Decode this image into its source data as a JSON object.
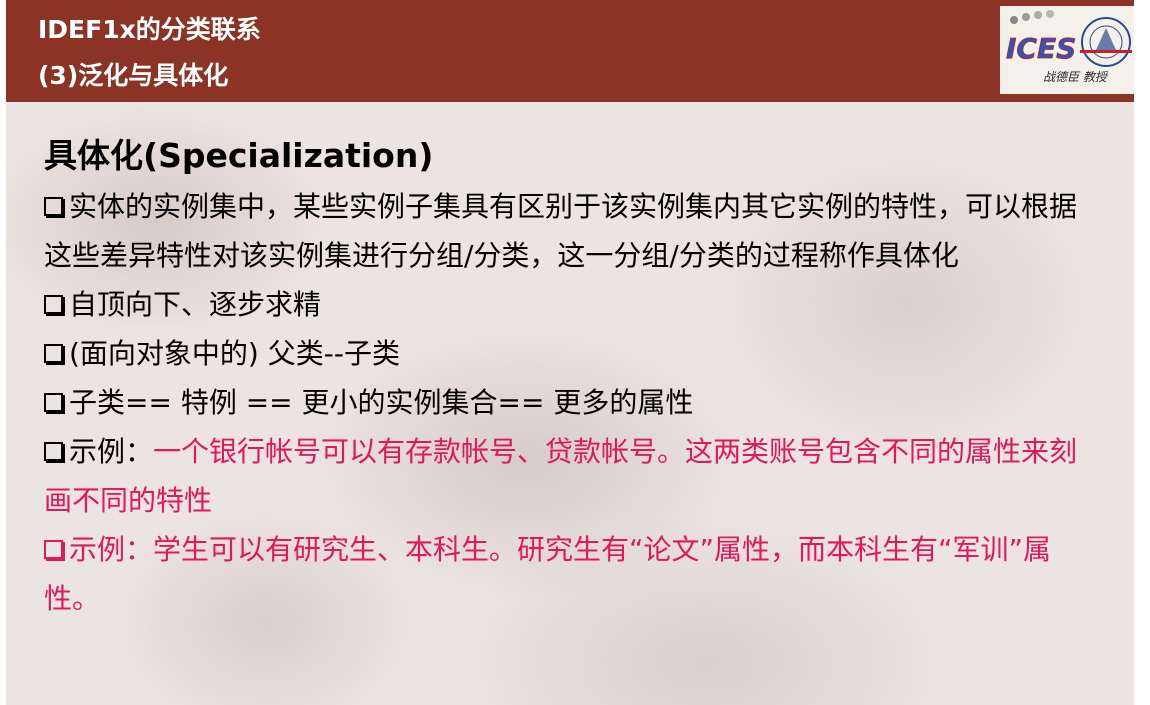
{
  "header": {
    "title_line1": "IDEF1x的分类联系",
    "title_line2": "(3)泛化与具体化",
    "logo_caption": "战德臣 教授",
    "logo_text": "ICES"
  },
  "colors": {
    "header_bg": "#8b3425",
    "accent_red": "#e0185e"
  },
  "content": {
    "heading": "具体化(Specialization)",
    "p1": "实体的实例集中，某些实例子集具有区别于该实例集内其它实例的特性，可以根据这些差异特性对该实例集进行分组/分类，这一分组/分类的过程称作具体化",
    "p2": "自顶向下、逐步求精",
    "p3": "(面向对象中的) 父类--子类",
    "p4": "子类== 特例 == 更小的实例集合== 更多的属性",
    "p5_prefix": "示例：",
    "p5_red": "一个银行帐号可以有存款帐号、贷款帐号。这两类账号包含不同的属性来刻画不同的特性",
    "p6": "示例：学生可以有研究生、本科生。研究生有“论文”属性，而本科生有“军训”属性。"
  }
}
